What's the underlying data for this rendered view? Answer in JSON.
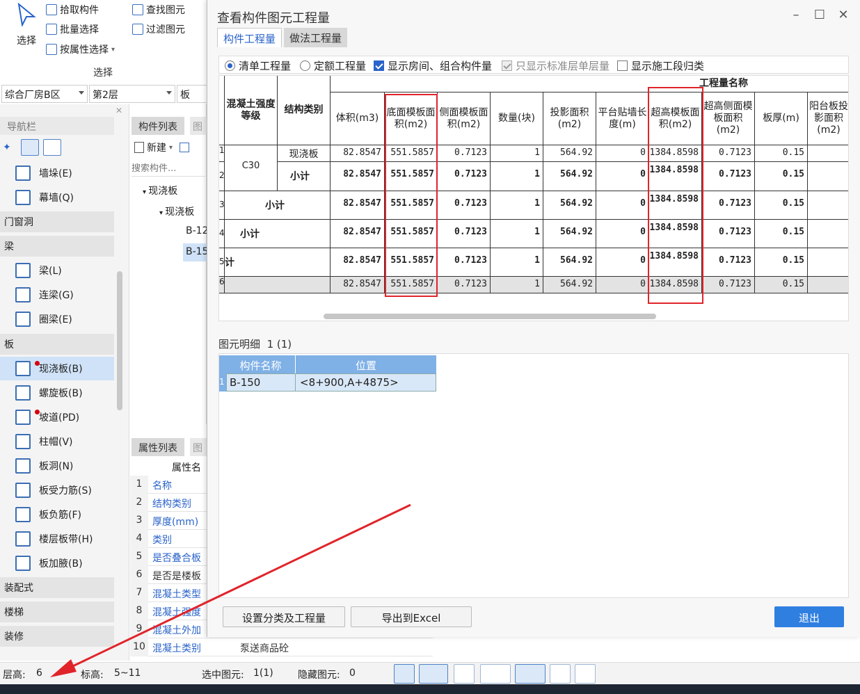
{
  "ribbon": {
    "select_label": "选择",
    "pick_component": "拾取构件",
    "batch_select": "批量选择",
    "select_by_attr": "按属性选择",
    "find_element": "查找图元",
    "filter_element": "过滤图元",
    "group_label": "选择"
  },
  "dropdowns": {
    "building": "综合厂房B区",
    "floor": "第2层",
    "type": "板"
  },
  "nav": {
    "title": "导航栏",
    "items": [
      {
        "label": "墙垛(E)",
        "icon": "wall-pier-icon"
      },
      {
        "label": "幕墙(Q)",
        "icon": "curtain-wall-icon"
      }
    ],
    "group_doors": "门窗洞",
    "group_beam": "梁",
    "beam_items": [
      {
        "label": "梁(L)",
        "icon": "beam-icon"
      },
      {
        "label": "连梁(G)",
        "icon": "coupling-beam-icon"
      },
      {
        "label": "圈梁(E)",
        "icon": "ring-beam-icon"
      }
    ],
    "group_slab": "板",
    "slab_items": [
      {
        "label": "现浇板(B)",
        "icon": "cast-slab-icon"
      },
      {
        "label": "螺旋板(B)",
        "icon": "spiral-slab-icon"
      },
      {
        "label": "坡道(PD)",
        "icon": "ramp-icon"
      },
      {
        "label": "柱帽(V)",
        "icon": "column-cap-icon"
      },
      {
        "label": "板洞(N)",
        "icon": "slab-hole-icon"
      },
      {
        "label": "板受力筋(S)",
        "icon": "slab-rebar-icon"
      },
      {
        "label": "板负筋(F)",
        "icon": "negative-rebar-icon"
      },
      {
        "label": "楼层板带(H)",
        "icon": "slab-strip-icon"
      },
      {
        "label": "板加腋(B)",
        "icon": "slab-haunch-icon"
      }
    ],
    "group_prefab": "装配式",
    "group_stairs": "楼梯",
    "group_decor": "装修"
  },
  "complist": {
    "tab": "构件列表",
    "tab2": "图",
    "new_label": "新建",
    "search_placeholder": "搜索构件...",
    "tree_root": "现浇板",
    "tree_child": "现浇板",
    "item1": "B-12",
    "item2": "B-15"
  },
  "proplist": {
    "tab": "属性列表",
    "tab2": "图",
    "header": "属性名",
    "rows": [
      {
        "n": "1",
        "k": "名称",
        "v": ""
      },
      {
        "n": "2",
        "k": "结构类别",
        "v": ""
      },
      {
        "n": "3",
        "k": "厚度(mm)",
        "v": ""
      },
      {
        "n": "4",
        "k": "类别",
        "v": ""
      },
      {
        "n": "5",
        "k": "是否叠合板",
        "v": ""
      },
      {
        "n": "6",
        "k": "是否是楼板",
        "v": ""
      },
      {
        "n": "7",
        "k": "混凝土类型",
        "v": ""
      },
      {
        "n": "8",
        "k": "混凝土强度",
        "v": ""
      },
      {
        "n": "9",
        "k": "混凝土外加",
        "v": ""
      },
      {
        "n": "10",
        "k": "混凝土类别",
        "v": "泵送商品砼"
      }
    ]
  },
  "status": {
    "floor_height_label": "层高:",
    "floor_height": "6",
    "elev_label": "标高:",
    "elev": "5~11",
    "selected_label": "选中图元:",
    "selected": "1(1)",
    "hidden_label": "隐藏图元:",
    "hidden": "0"
  },
  "dialog": {
    "title": "查看构件图元工程量",
    "tab_component": "构件工程量",
    "tab_method": "做法工程量",
    "opt_bill": "清单工程量",
    "opt_quota": "定额工程量",
    "opt_show_room": "显示房间、组合构件量",
    "opt_std_floor": "只显示标准层单层量",
    "opt_show_stage": "显示施工段归类",
    "group_header": "工程量名称",
    "headers": {
      "grade": "混凝土强度等级",
      "struct": "结构类别",
      "vol": "体积(m3)",
      "bottom": "底面模板面积(m2)",
      "side": "侧面模板面积(m2)",
      "count": "数量(块)",
      "proj": "投影面积(m2)",
      "platform": "平台贴墙长度(m)",
      "overh": "超高模板面积(m2)",
      "overside": "超高侧面模板面积(m2)",
      "thick": "板厚(m)",
      "balcony": "阳台板投影面积(m2)"
    },
    "grade_value": "C30",
    "rows": [
      {
        "n": "1",
        "label": "现浇板",
        "vol": "82.8547",
        "bottom": "551.5857",
        "side": "0.7123",
        "count": "1",
        "proj": "564.92",
        "platform": "0",
        "overh": "1384.8598",
        "overside": "0.7123",
        "thick": "0.15"
      },
      {
        "n": "2",
        "label": "小计",
        "vol": "82.8547",
        "bottom": "551.5857",
        "side": "0.7123",
        "count": "1",
        "proj": "564.92",
        "platform": "0",
        "overh": "1384.8598",
        "overside": "0.7123",
        "thick": "0.15"
      },
      {
        "n": "3",
        "label": "小计",
        "vol": "82.8547",
        "bottom": "551.5857",
        "side": "0.7123",
        "count": "1",
        "proj": "564.92",
        "platform": "0",
        "overh": "1384.8598",
        "overside": "0.7123",
        "thick": "0.15"
      },
      {
        "n": "4",
        "label": "小计",
        "vol": "82.8547",
        "bottom": "551.5857",
        "side": "0.7123",
        "count": "1",
        "proj": "564.92",
        "platform": "0",
        "overh": "1384.8598",
        "overside": "0.7123",
        "thick": "0.15"
      },
      {
        "n": "5",
        "label": "计",
        "vol": "82.8547",
        "bottom": "551.5857",
        "side": "0.7123",
        "count": "1",
        "proj": "564.92",
        "platform": "0",
        "overh": "1384.8598",
        "overside": "0.7123",
        "thick": "0.15"
      },
      {
        "n": "6",
        "label": "",
        "vol": "82.8547",
        "bottom": "551.5857",
        "side": "0.7123",
        "count": "1",
        "proj": "564.92",
        "platform": "0",
        "overh": "1384.8598",
        "overside": "0.7123",
        "thick": "0.15"
      }
    ],
    "detail_label": "图元明细",
    "detail_count": "1 (1)",
    "detail_header_name": "构件名称",
    "detail_header_pos": "位置",
    "detail_row_n": "1",
    "detail_row_name": "B-150",
    "detail_row_pos": "<8+900,A+4875>",
    "btn_setup": "设置分类及工程量",
    "btn_export": "导出到Excel",
    "btn_exit": "退出"
  },
  "colors": {
    "accent": "#2a63c9",
    "highlight": "#e0242a",
    "primary_button": "#2f7fe0"
  }
}
